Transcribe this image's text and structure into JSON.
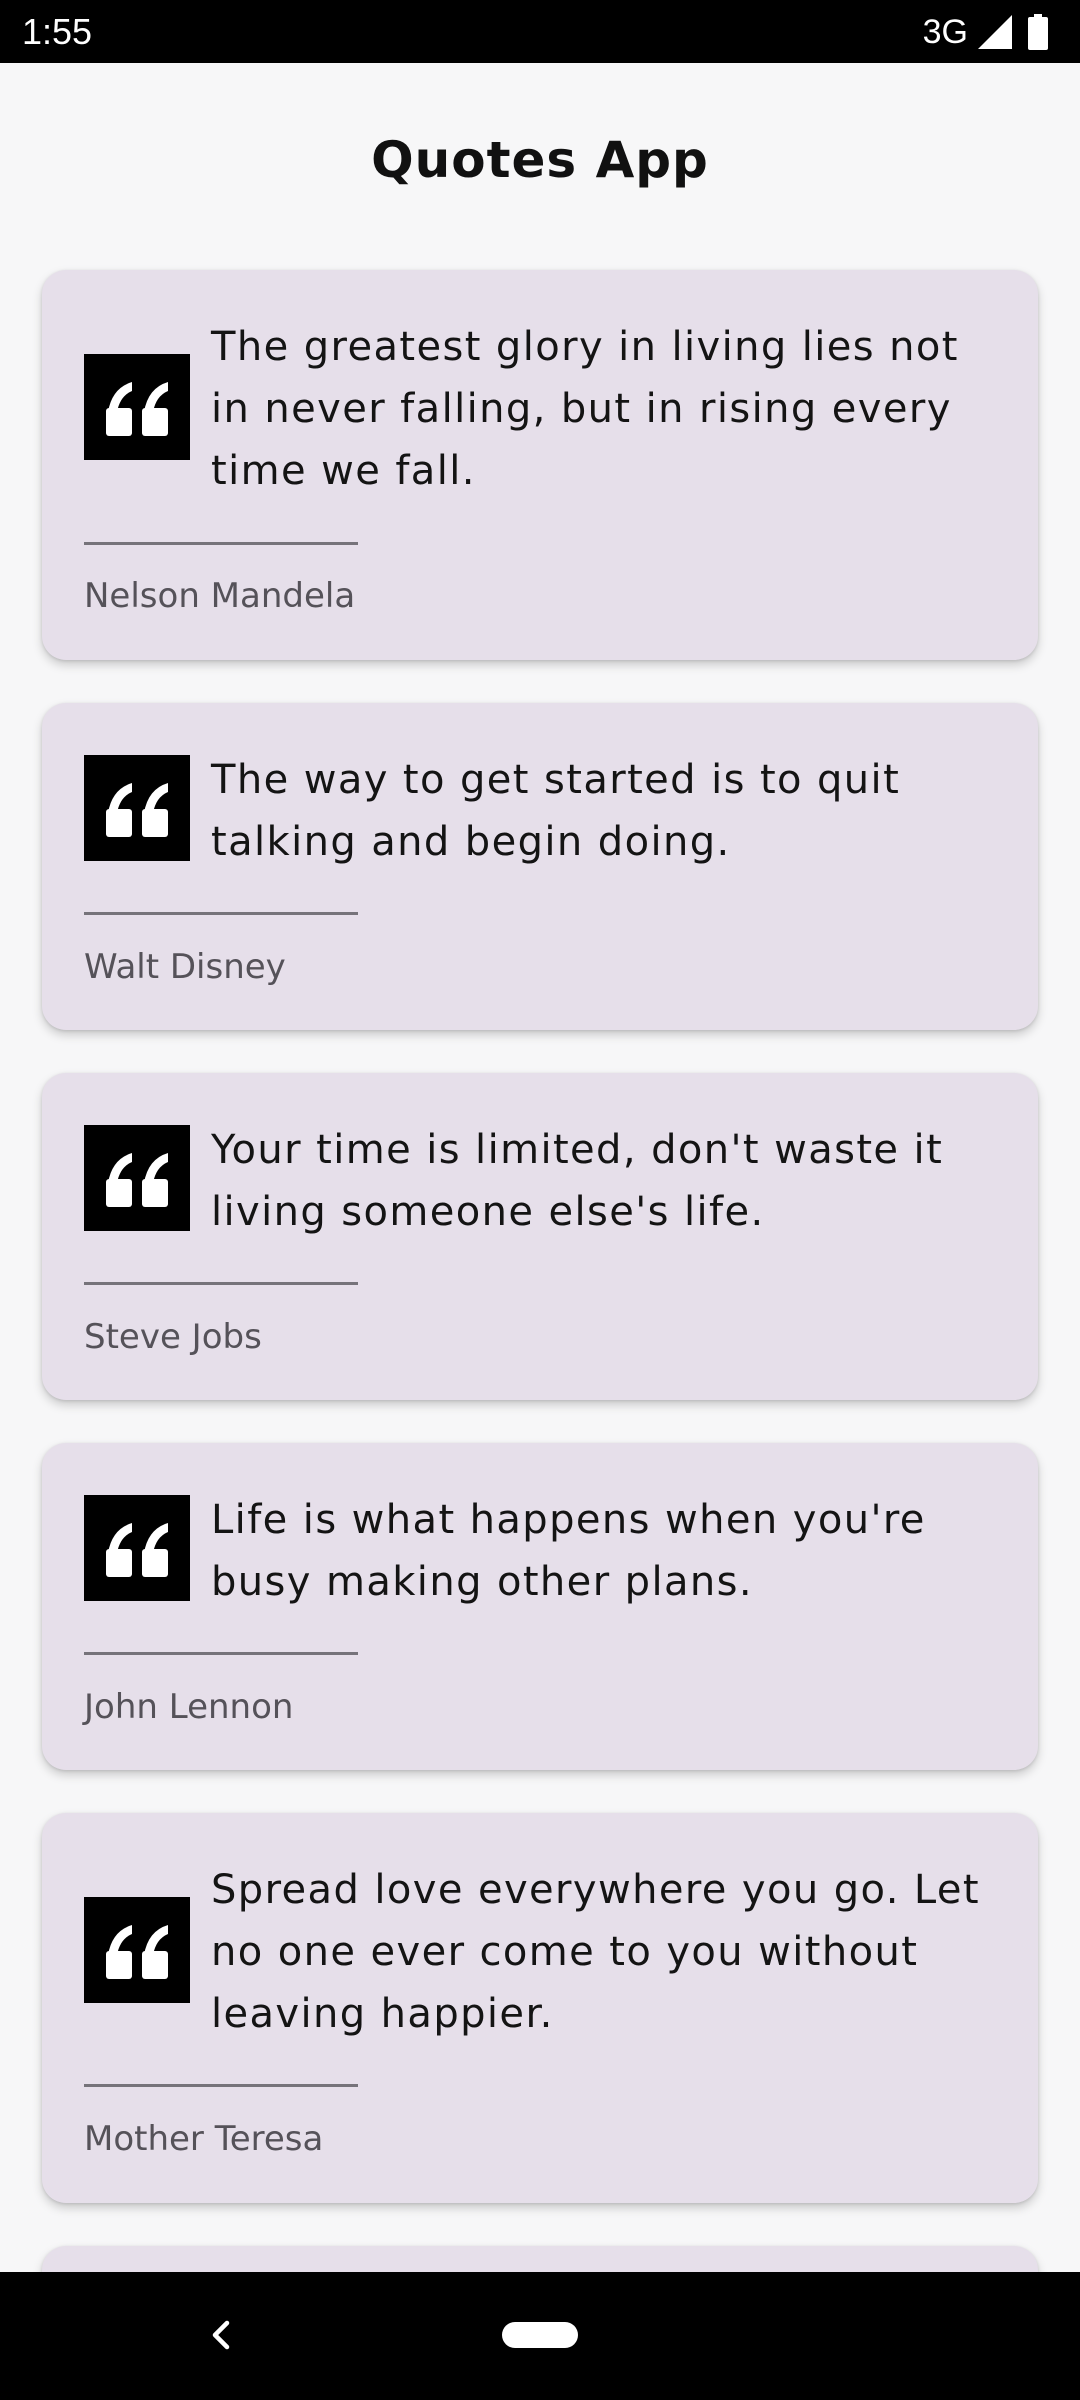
{
  "status_bar": {
    "time": "1:55",
    "network": "3G",
    "signal_icon": "signal-icon",
    "battery_icon": "battery-icon"
  },
  "app": {
    "title": "Quotes App"
  },
  "quotes": [
    {
      "text": "The greatest glory in living lies not in never falling, but in rising every time we fall.",
      "author": "Nelson Mandela"
    },
    {
      "text": "The way to get started is to quit talking and begin doing.",
      "author": "Walt Disney"
    },
    {
      "text": "Your time is limited, don't waste it living someone else's life.",
      "author": "Steve Jobs"
    },
    {
      "text": "Life is what happens when you're busy making other plans.",
      "author": "John Lennon"
    },
    {
      "text": "Spread love everywhere you go. Let no one ever come to you without leaving happier.",
      "author": "Mother Teresa"
    }
  ],
  "nav_bar": {
    "back_icon": "back-icon",
    "home_icon": "home-pill-icon"
  },
  "colors": {
    "card_background": "#e6dfea",
    "page_background": "#f7f7f8",
    "quote_icon_background": "#000000",
    "divider": "#76737a",
    "author_text": "#555259"
  }
}
